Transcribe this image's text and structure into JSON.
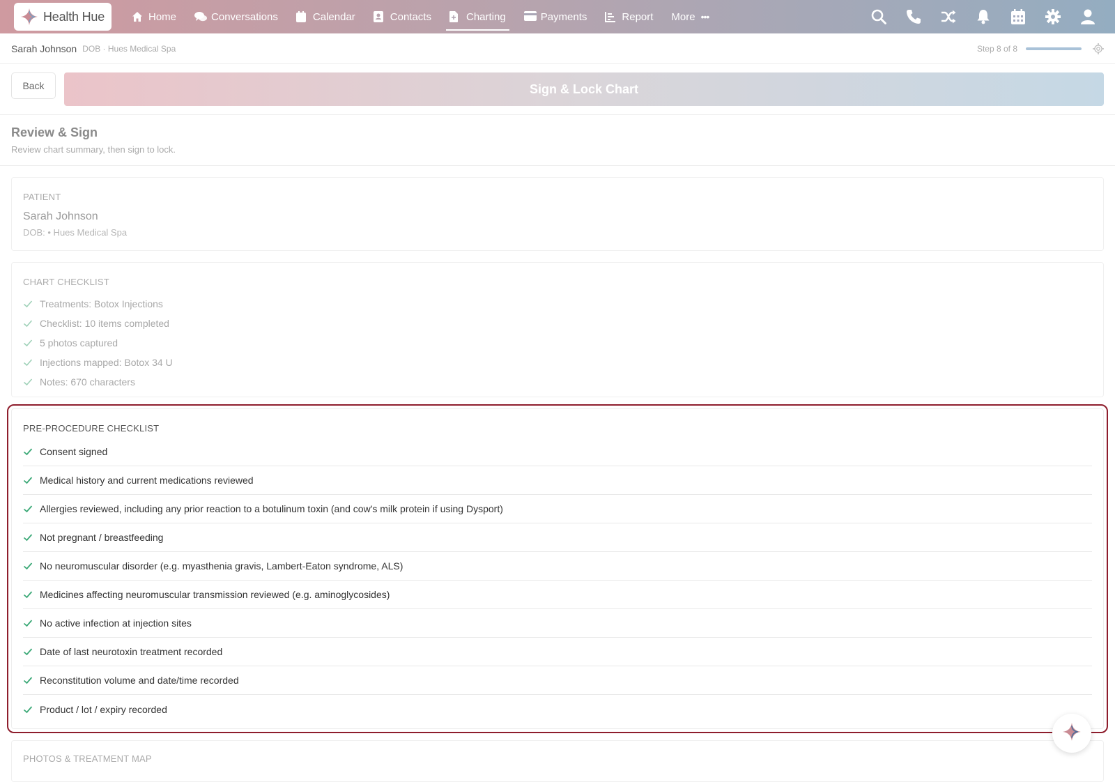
{
  "brand": {
    "name": "Health Hue"
  },
  "nav": {
    "items": [
      {
        "label": "Home",
        "icon": "home-icon"
      },
      {
        "label": "Conversations",
        "icon": "chat-icon"
      },
      {
        "label": "Calendar",
        "icon": "calendar-icon"
      },
      {
        "label": "Contacts",
        "icon": "contact-icon"
      },
      {
        "label": "Charting",
        "icon": "document-icon",
        "active": true
      },
      {
        "label": "Payments",
        "icon": "card-icon"
      },
      {
        "label": "Report",
        "icon": "report-icon"
      }
    ],
    "more_label": "More",
    "right_icons": [
      "search-icon",
      "phone-icon",
      "shuffle-icon",
      "bell-icon",
      "calendar-grid-icon",
      "gear-icon",
      "user-icon"
    ]
  },
  "subheader": {
    "patient_name": "Sarah Johnson",
    "meta": "DOB · Hues Medical Spa",
    "step_text": "Step 8 of 8",
    "step_progress": 1.0
  },
  "actions": {
    "back_label": "Back",
    "sign_label": "Sign & Lock Chart"
  },
  "page": {
    "title": "Review & Sign",
    "subtitle": "Review chart summary, then sign to lock."
  },
  "patient_card": {
    "title": "PATIENT",
    "name": "Sarah Johnson",
    "meta": "DOB: • Hues Medical Spa"
  },
  "chart_checklist": {
    "title": "CHART CHECKLIST",
    "items": [
      "Treatments: Botox Injections",
      "Checklist: 10 items completed",
      "5 photos captured",
      "Injections mapped: Botox 34 U",
      "Notes: 670 characters"
    ]
  },
  "pre_procedure": {
    "title": "PRE-PROCEDURE CHECKLIST",
    "items": [
      "Consent signed",
      "Medical history and current medications reviewed",
      "Allergies reviewed, including any prior reaction to a botulinum toxin (and cow's milk protein if using Dysport)",
      "Not pregnant / breastfeeding",
      "No neuromuscular disorder (e.g. myasthenia gravis, Lambert-Eaton syndrome, ALS)",
      "Medicines affecting neuromuscular transmission reviewed (e.g. aminoglycosides)",
      "No active infection at injection sites",
      "Date of last neurotoxin treatment recorded",
      "Reconstitution volume and date/time recorded",
      "Product / lot / expiry recorded"
    ]
  },
  "photos_card": {
    "title": "PHOTOS & TREATMENT MAP"
  },
  "colors": {
    "check": "#3aa876",
    "focus_ring": "#8e1d2c",
    "sign_gradient_start": "#ebc4c9",
    "sign_gradient_end": "#c5d8e5"
  }
}
